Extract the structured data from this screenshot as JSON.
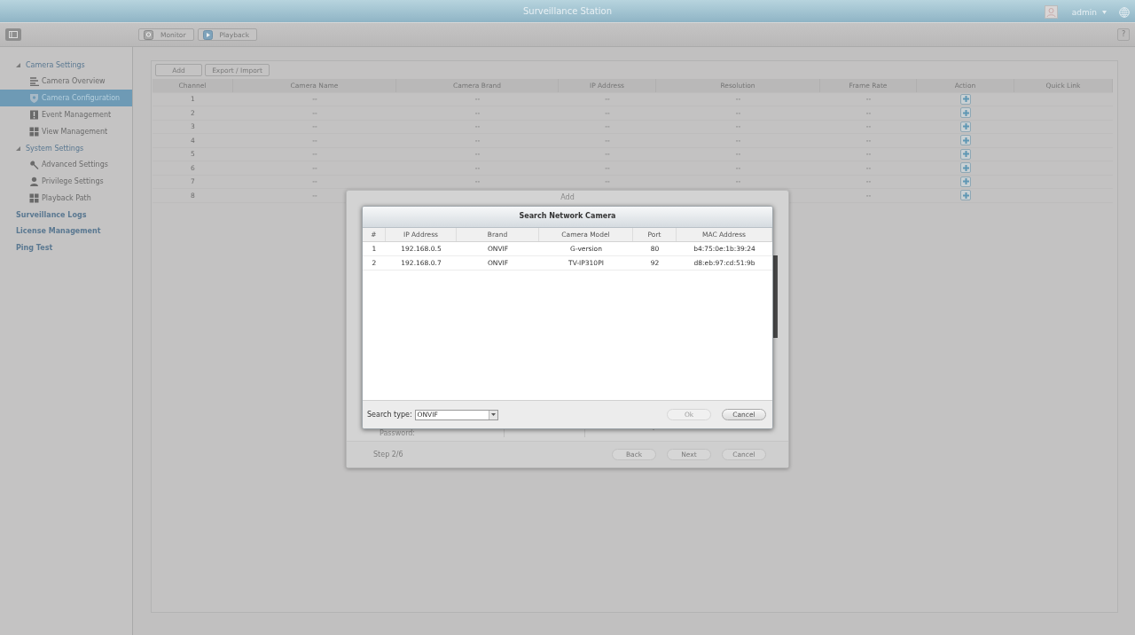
{
  "window": {
    "title": "Surveillance Station",
    "user": "admin"
  },
  "toolbar": {
    "buttons": [
      {
        "label": "Monitor",
        "kind": "monitor"
      },
      {
        "label": "Playback",
        "kind": "playback"
      }
    ],
    "help": "?"
  },
  "sidebar": {
    "items": [
      {
        "label": "Camera Settings",
        "kind": "group",
        "expanded": true,
        "children": [
          {
            "label": "Camera Overview",
            "kind": "overview",
            "selected": false
          },
          {
            "label": "Camera Configuration",
            "kind": "camera",
            "selected": true
          },
          {
            "label": "Event Management",
            "kind": "event",
            "selected": false
          },
          {
            "label": "View Management",
            "kind": "grid",
            "selected": false
          }
        ]
      },
      {
        "label": "System Settings",
        "kind": "group",
        "expanded": true,
        "children": [
          {
            "label": "Advanced Settings",
            "kind": "wrench",
            "selected": false
          },
          {
            "label": "Privilege Settings",
            "kind": "person",
            "selected": false
          },
          {
            "label": "Playback Path",
            "kind": "grid",
            "selected": false
          }
        ]
      },
      {
        "label": "Surveillance Logs",
        "kind": "link"
      },
      {
        "label": "License Management",
        "kind": "link"
      },
      {
        "label": "Ping Test",
        "kind": "link"
      }
    ]
  },
  "camera_table": {
    "buttons": [
      "Add",
      "Export / Import"
    ],
    "columns": [
      "Channel",
      "Camera Name",
      "Camera Brand",
      "IP Address",
      "Resolution",
      "Frame Rate",
      "Action",
      "Quick Link"
    ],
    "rows": [
      {
        "channel": "1",
        "camera_name": "--",
        "camera_brand": "--",
        "ip_address": "--",
        "resolution": "--",
        "frame_rate": "--"
      },
      {
        "channel": "2",
        "camera_name": "--",
        "camera_brand": "--",
        "ip_address": "--",
        "resolution": "--",
        "frame_rate": "--"
      },
      {
        "channel": "3",
        "camera_name": "--",
        "camera_brand": "--",
        "ip_address": "--",
        "resolution": "--",
        "frame_rate": "--"
      },
      {
        "channel": "4",
        "camera_name": "--",
        "camera_brand": "--",
        "ip_address": "--",
        "resolution": "--",
        "frame_rate": "--"
      },
      {
        "channel": "5",
        "camera_name": "--",
        "camera_brand": "--",
        "ip_address": "--",
        "resolution": "--",
        "frame_rate": "--"
      },
      {
        "channel": "6",
        "camera_name": "--",
        "camera_brand": "--",
        "ip_address": "--",
        "resolution": "--",
        "frame_rate": "--"
      },
      {
        "channel": "7",
        "camera_name": "--",
        "camera_brand": "--",
        "ip_address": "--",
        "resolution": "--",
        "frame_rate": "--"
      },
      {
        "channel": "8",
        "camera_name": "--",
        "frame_rate": "--"
      }
    ]
  },
  "add_dialog": {
    "title": "Add",
    "password_label": "Password:",
    "step": "Step 2/6",
    "buttons": [
      "Back",
      "Next",
      "Cancel"
    ]
  },
  "search_dialog": {
    "title": "Search Network Camera",
    "columns": [
      "#",
      "IP Address",
      "Brand",
      "Camera Model",
      "Port",
      "MAC Address"
    ],
    "rows": [
      [
        "1",
        "192.168.0.5",
        "ONVIF",
        "G-version",
        "80",
        "b4:75:0e:1b:39:24"
      ],
      [
        "2",
        "192.168.0.7",
        "ONVIF",
        "TV-IP310PI",
        "92",
        "d8:eb:97:cd:51:9b"
      ]
    ],
    "search_type_label": "Search type:",
    "search_type": "ONVIF",
    "buttons": [
      {
        "label": "Ok",
        "disabled": true
      },
      {
        "label": "Cancel",
        "disabled": false
      }
    ]
  }
}
